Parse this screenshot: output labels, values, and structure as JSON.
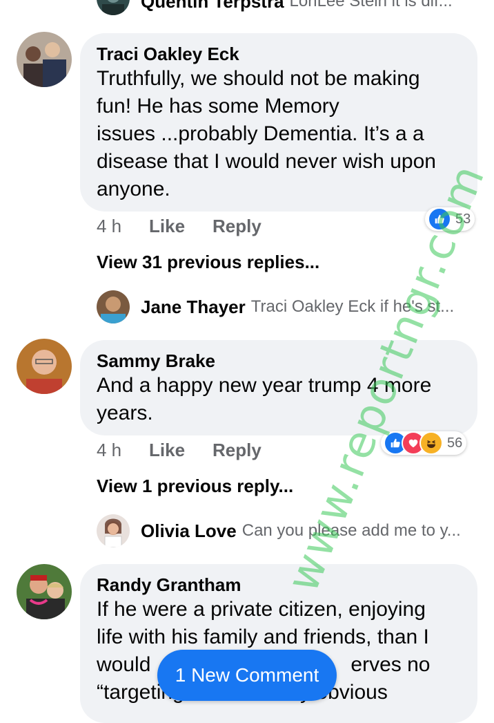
{
  "top_reply": {
    "name": "Quentin Terpstra",
    "text": "LoriLee Stein it is dif..."
  },
  "comments": [
    {
      "author": "Traci Oakley Eck",
      "text": "Truthfully, we should not be making fun! He has some Memory issues ...probably Dementia. It’s a a disease that I would never wish upon anyone.",
      "lines": [
        "Truthfully, we should not be making",
        "fun! He has some Memory",
        "issues ...probably Dementia. It’s a a",
        "disease that I would never wish upon",
        "anyone."
      ],
      "time": "4 h",
      "like": "Like",
      "reply": "Reply",
      "reaction_count": "53",
      "view_previous": "View 31 previous replies...",
      "latest_reply": {
        "name": "Jane Thayer",
        "text": "Traci Oakley Eck if he's st..."
      }
    },
    {
      "author": "Sammy Brake",
      "text": "And a happy new year trump 4 more years.",
      "lines": [
        "And a happy new year trump 4 more",
        "years."
      ],
      "time": "4 h",
      "like": "Like",
      "reply": "Reply",
      "reaction_count": "56",
      "view_previous": "View 1 previous reply...",
      "latest_reply": {
        "name": "Olivia Love",
        "text": "Can you please add me to y..."
      }
    },
    {
      "author": "Randy Grantham",
      "lines": [
        "If he were a private citizen, enjoying",
        "life with his family and friends, than I",
        "would",
        "erves no",
        "“targeting",
        "fully obvious"
      ]
    }
  ],
  "new_comment_button": "1 New Comment",
  "watermark": "www.reportngr.com",
  "colors": {
    "bubble": "#f0f2f5",
    "meta": "#65676b",
    "accent": "#1877f2",
    "love": "#f33e58",
    "haha": "#f7b125"
  },
  "icons": [
    "like-reaction-icon",
    "love-reaction-icon",
    "haha-reaction-icon"
  ]
}
